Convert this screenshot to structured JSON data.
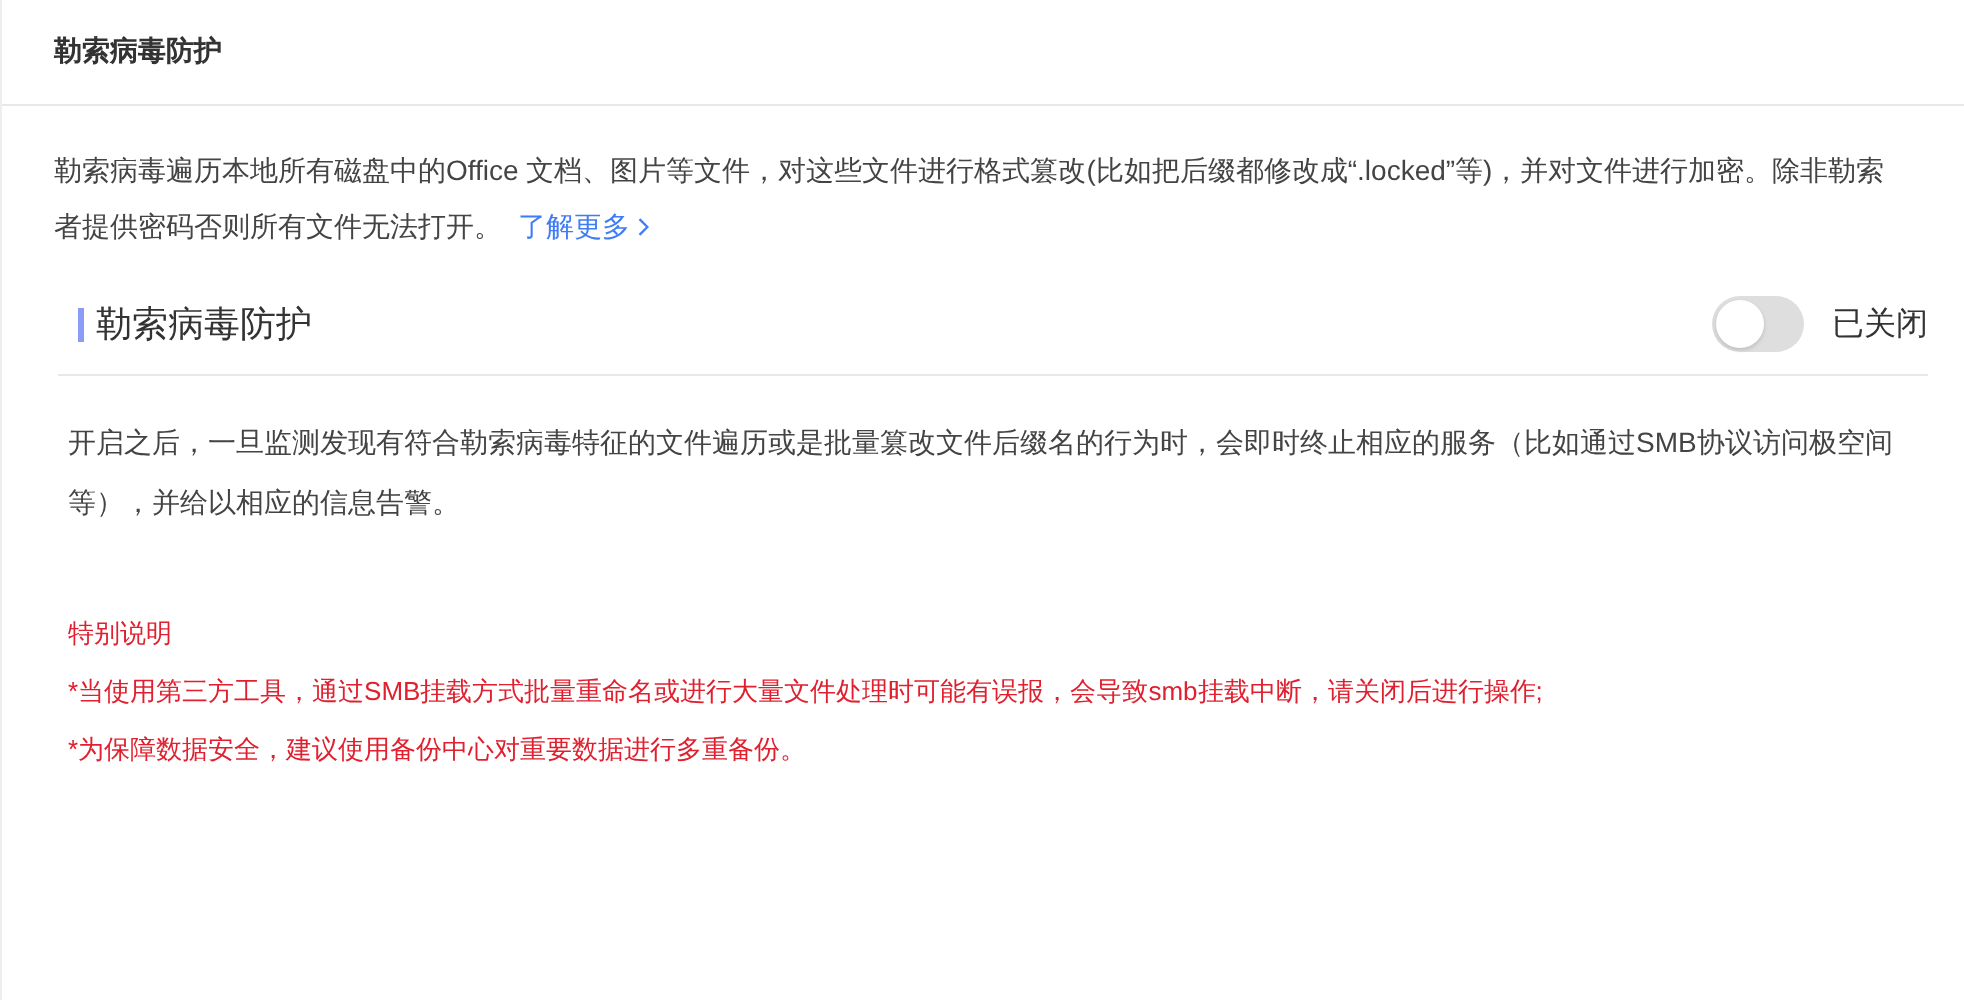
{
  "header": {
    "title": "勒索病毒防护"
  },
  "intro": {
    "text": "勒索病毒遍历本地所有磁盘中的Office 文档、图片等文件，对这些文件进行格式篡改(比如把后缀都修改成“.locked”等)，并对文件进行加密。除非勒索者提供密码否则所有文件无法打开。",
    "link": "了解更多"
  },
  "setting": {
    "title": "勒索病毒防护",
    "on": false,
    "status": "已关闭",
    "description": "开启之后，一旦监测发现有符合勒索病毒特征的文件遍历或是批量篡改文件后缀名的行为时，会即时终止相应的服务（比如通过SMB协议访问极空间等），并给以相应的信息告警。"
  },
  "notes": {
    "title": "特别说明",
    "items": [
      "*当使用第三方工具，通过SMB挂载方式批量重命名或进行大量文件处理时可能有误报，会导致smb挂载中断，请关闭后进行操作;",
      "*为保障数据安全，建议使用备份中心对重要数据进行多重备份。"
    ]
  }
}
